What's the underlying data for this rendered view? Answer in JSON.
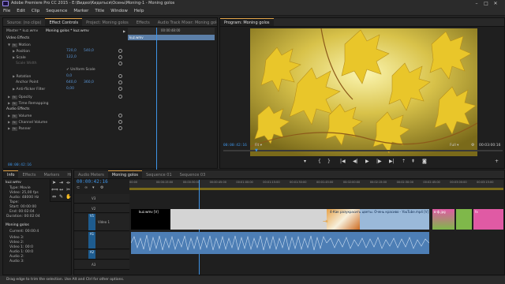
{
  "titlebar": {
    "title": "Adobe Premiere Pro CC 2015 - E:\\Видео\\Кидаться\\Осень\\Moning-1 - Moning golos"
  },
  "menu": [
    "File",
    "Edit",
    "Clip",
    "Sequence",
    "Marker",
    "Title",
    "Window",
    "Help"
  ],
  "top_left": {
    "tabs": [
      "Source: (no clips)",
      "Effect Controls",
      "Project: Moning golos",
      "Effects",
      "Audio Track Mixer: Moning golo"
    ],
    "active_tab": 1,
    "header": "Master * kuz.wmv",
    "seq_label": "Moning golos * kuz.wmv",
    "ruler_time": "00:00:48:00",
    "clip_label": "kuz.wmv",
    "sections": {
      "video": "Video Effects",
      "motion": "Motion",
      "position": "Position",
      "position_x": "720,0",
      "position_y": "540,0",
      "scale": "Scale",
      "scale_val": "122,0",
      "scale_width": "Scale Width",
      "uniform": "Uniform Scale",
      "rotation": "Rotation",
      "rotation_val": "0,0",
      "anchor": "Anchor Point",
      "anchor_x": "640,0",
      "anchor_y": "360,0",
      "antiflicker": "Anti-flicker Filter",
      "antiflicker_val": "0,00",
      "opacity": "Opacity",
      "time_remap": "Time Remapping",
      "audio": "Audio Effects",
      "volume": "Volume",
      "channel_volume": "Channel Volume",
      "panner": "Panner"
    },
    "footer_time": "00:00:42:16"
  },
  "program": {
    "tab": "Program: Moning golos",
    "timecode": "00:00:42:16",
    "fit": "Fit",
    "quality": "Full",
    "duration": "00:03:00:16"
  },
  "info": {
    "tabs": [
      "Info",
      "Effects",
      "Markers",
      "History"
    ],
    "clip": "kuz.wmv",
    "type_label": "Type:",
    "type": "Movie",
    "video_label": "Video:",
    "video": "25,00 fps",
    "audio_label": "Audio:",
    "audio": "48000 Hz",
    "tape_label": "Tape:",
    "start_label": "Start:",
    "start": "00:00:00",
    "end_label": "End:",
    "end": "00:02:04",
    "dur_label": "Duration:",
    "dur": "00:02:04",
    "seq": "Moning golos",
    "current_label": "Current:",
    "current": "00:00:4",
    "tracks": [
      {
        "label": "Video 3:",
        "value": ""
      },
      {
        "label": "Video 2:",
        "value": ""
      },
      {
        "label": "Video 1:",
        "value": "00:0"
      },
      {
        "label": "Audio 1:",
        "value": "00:0"
      },
      {
        "label": "Audio 2:",
        "value": ""
      },
      {
        "label": "Audio 3:",
        "value": ""
      }
    ]
  },
  "timeline": {
    "tabs": [
      "Audio Meters",
      "Moning golos",
      "Sequence 01",
      "Sequence 03"
    ],
    "active_tab": 1,
    "timecode": "00:00:42:16",
    "ruler_ticks": [
      "00:00",
      "00:00:15:00",
      "00:00:30:00",
      "00:00:45:00",
      "00:01:00:00",
      "00:01:15:00",
      "00:01:30:00",
      "00:01:45:00",
      "00:02:00:00",
      "00:02:15:00",
      "00:02:30:00",
      "00:02:45:00",
      "00:03:00:00",
      "00:03:15:00"
    ],
    "tracks": {
      "v3": "V3",
      "v2": "V2",
      "v1": "V1",
      "v1_name": "Video 1",
      "a1": "A1",
      "a2": "A2",
      "a3": "A3"
    },
    "clips": {
      "kuz": "kuz.wmv [V]",
      "clip2": "4-Как разукрасить цветы. Очень красиво - YouTube.mp4 [V]",
      "clip3": "в-ф.jpg",
      "fx": "fx"
    }
  },
  "status": "Drag edge to trim the selection. Use Alt and Ctrl for other options.",
  "colors": {
    "accent_timecode": "#3e93e6",
    "video_clip": "#9ab9d9",
    "audio_clip": "#4d7eb5",
    "playhead": "#3e93e6",
    "active_tab_underline": "#e4a64c"
  }
}
